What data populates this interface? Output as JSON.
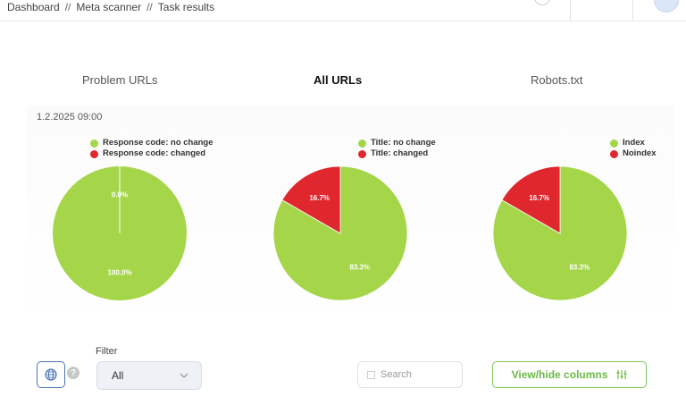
{
  "breadcrumb": {
    "items": [
      "Dashboard",
      "Meta scanner",
      "Task results"
    ],
    "separator": "//"
  },
  "tabs": [
    {
      "label": "Problem URLs",
      "active": false
    },
    {
      "label": "All URLs",
      "active": true
    },
    {
      "label": "Robots.txt",
      "active": false
    }
  ],
  "panel": {
    "date": "1.2.2025 09:00"
  },
  "colors": {
    "green": "#a5d64a",
    "red": "#e0272e",
    "accent": "#4b74b8",
    "button_green": "#6aba45"
  },
  "chart_data": [
    {
      "type": "pie",
      "legend_placement": "top-right",
      "series": [
        {
          "name": "Response code: no change",
          "value": 100.0,
          "label": "100.0%",
          "color": "#a5d64a"
        },
        {
          "name": "Response code: changed",
          "value": 0.0,
          "label": "0.0%",
          "color": "#e0272e"
        }
      ]
    },
    {
      "type": "pie",
      "legend_placement": "top-right",
      "series": [
        {
          "name": "Title: no change",
          "value": 83.3,
          "label": "83.3%",
          "color": "#a5d64a"
        },
        {
          "name": "Title: changed",
          "value": 16.7,
          "label": "16.7%",
          "color": "#e0272e"
        }
      ]
    },
    {
      "type": "pie",
      "legend_placement": "top-right",
      "series": [
        {
          "name": "Index",
          "value": 83.3,
          "label": "83.3%",
          "color": "#a5d64a"
        },
        {
          "name": "Noindex",
          "value": 16.7,
          "label": "16.7%",
          "color": "#e0272e"
        }
      ]
    }
  ],
  "controls": {
    "filter_label": "Filter",
    "filter_value": "All",
    "search_placeholder": "Search",
    "view_columns_label": "View/hide columns",
    "help_label": "?"
  },
  "icons": {
    "globe": "globe-icon",
    "search": "search-icon",
    "chevron": "chevron-down-icon",
    "sliders": "sliders-icon",
    "help": "help-icon"
  }
}
